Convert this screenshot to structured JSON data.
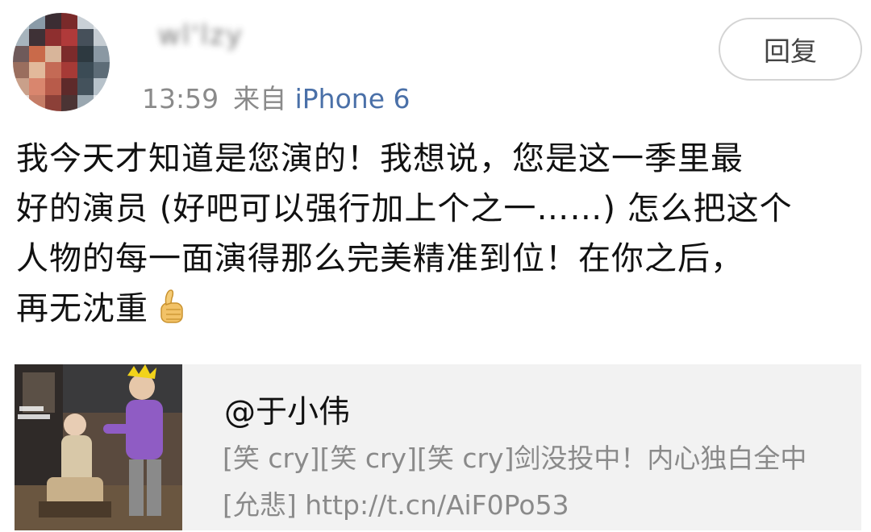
{
  "comment": {
    "author": {
      "name": "wl'lzy",
      "avatar": "blurred-avatar-icon"
    },
    "time": "13:59",
    "source_prefix": "来自",
    "device": "iPhone 6",
    "reply_label": "回复",
    "text_lines": [
      "我今天才知道是您演的！我想说，您是这一季里最",
      "好的演员 (好吧可以强行加上个之一……) 怎么把这个",
      "人物的每一面演得那么完美精准到位！在你之后，",
      "再无沈重"
    ],
    "emoji": "thumbs-up-icon"
  },
  "quoted_card": {
    "user": "@于小伟",
    "line1": "[笑 cry][笑 cry][笑 cry]剑没投中！内心独白全中",
    "line2": "[允悲] http://t.cn/AiF0Po53"
  },
  "colors": {
    "meta_gray": "#8a8a8a",
    "link_blue": "#4a70a8",
    "card_bg": "#f2f2f2",
    "button_border": "#d4d4d4"
  }
}
